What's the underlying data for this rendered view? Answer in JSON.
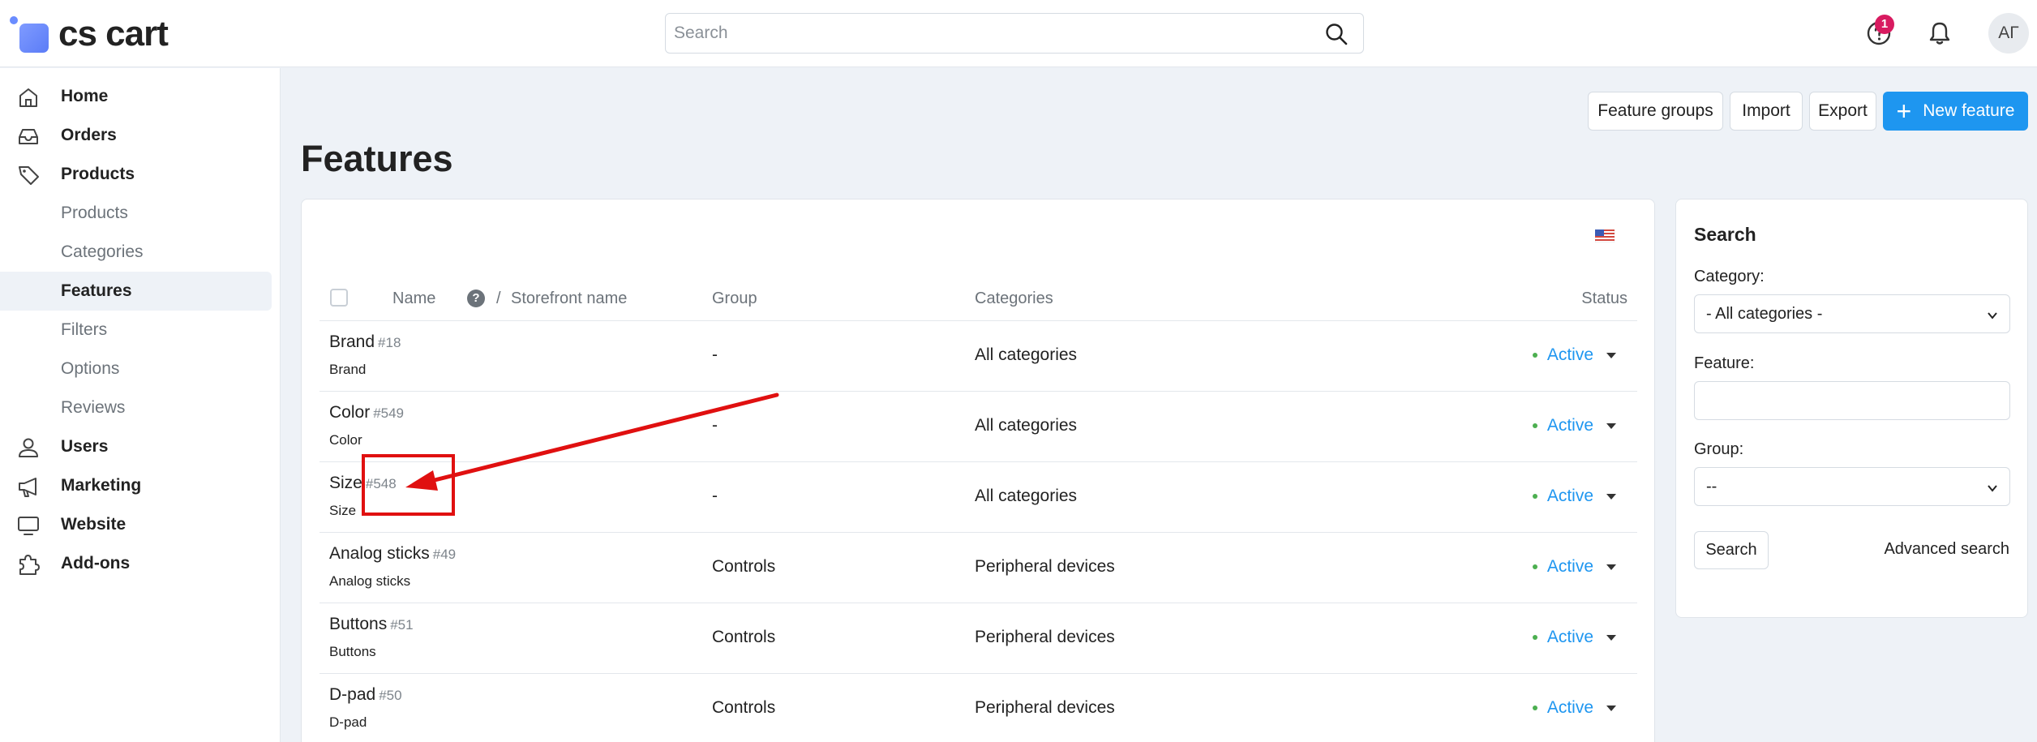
{
  "app": {
    "logo_text": "cs cart"
  },
  "header": {
    "search_placeholder": "Search",
    "notification_badge": "1",
    "user_initials": "АГ"
  },
  "sidebar": {
    "items": [
      {
        "label": "Home",
        "icon": "home-icon"
      },
      {
        "label": "Orders",
        "icon": "inbox-icon"
      },
      {
        "label": "Products",
        "icon": "tag-icon"
      },
      {
        "label": "Products",
        "sub": true
      },
      {
        "label": "Categories",
        "sub": true
      },
      {
        "label": "Features",
        "sub": true,
        "active": true
      },
      {
        "label": "Filters",
        "sub": true
      },
      {
        "label": "Options",
        "sub": true
      },
      {
        "label": "Reviews",
        "sub": true
      },
      {
        "label": "Users",
        "icon": "user-icon"
      },
      {
        "label": "Marketing",
        "icon": "megaphone-icon"
      },
      {
        "label": "Website",
        "icon": "monitor-icon"
      },
      {
        "label": "Add-ons",
        "icon": "puzzle-icon"
      }
    ]
  },
  "toolbar": {
    "feature_groups": "Feature groups",
    "import": "Import",
    "export": "Export",
    "new_feature": "New feature"
  },
  "page": {
    "title": "Features"
  },
  "table": {
    "columns": {
      "name": "Name",
      "storefront_sep": "/",
      "storefront_name": "Storefront name",
      "group": "Group",
      "categories": "Categories",
      "status": "Status"
    },
    "rows": [
      {
        "name": "Brand",
        "id": "#18",
        "storefront": "Brand",
        "group": "-",
        "categories": "All categories",
        "status": "Active"
      },
      {
        "name": "Color",
        "id": "#549",
        "storefront": "Color",
        "group": "-",
        "categories": "All categories",
        "status": "Active"
      },
      {
        "name": "Size",
        "id": "#548",
        "storefront": "Size",
        "group": "-",
        "categories": "All categories",
        "status": "Active"
      },
      {
        "name": "Analog sticks",
        "id": "#49",
        "storefront": "Analog sticks",
        "group": "Controls",
        "categories": "Peripheral devices",
        "status": "Active"
      },
      {
        "name": "Buttons",
        "id": "#51",
        "storefront": "Buttons",
        "group": "Controls",
        "categories": "Peripheral devices",
        "status": "Active"
      },
      {
        "name": "D-pad",
        "id": "#50",
        "storefront": "D-pad",
        "group": "Controls",
        "categories": "Peripheral devices",
        "status": "Active"
      }
    ]
  },
  "search_panel": {
    "title": "Search",
    "category_label": "Category:",
    "category_value": "- All categories -",
    "feature_label": "Feature:",
    "feature_value": "",
    "group_label": "Group:",
    "group_value": "--",
    "search_button": "Search",
    "advanced_search": "Advanced search"
  },
  "colors": {
    "accent": "#1e96f0",
    "status_dot": "#4caf50",
    "badge": "#d81b60",
    "annotation": "#e01010"
  }
}
